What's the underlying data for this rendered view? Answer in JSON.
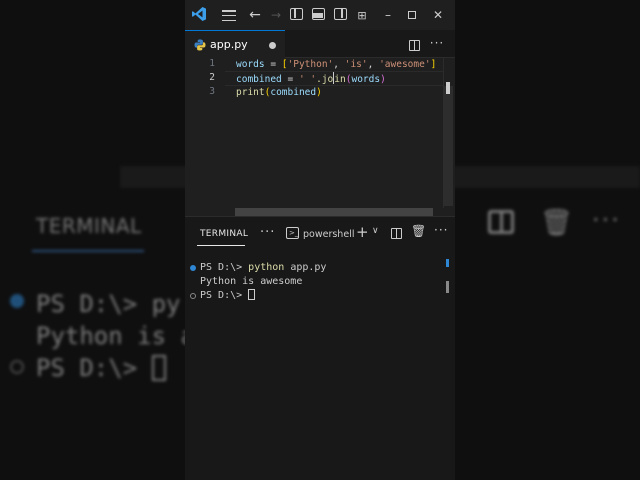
{
  "background": {
    "terminal_label": "TERMINAL",
    "lines": [
      "PS D:\\> py",
      "Python is a",
      "PS D:\\> "
    ]
  },
  "window": {
    "tab": {
      "filename": "app.py",
      "modified": true
    },
    "editor": {
      "line_numbers": [
        "1",
        "2",
        "3"
      ],
      "code": {
        "l1": {
          "v": "words",
          "eq": " = ",
          "br1": "[",
          "s1": "'Python'",
          "c1": ", ",
          "s2": "'is'",
          "c2": ", ",
          "s3": "'awesome'",
          "br2": "]"
        },
        "l2": {
          "v": "combined",
          "eq": " = ",
          "s": "' '",
          "dot": ".jo",
          "f2": "in",
          "p1": "(",
          "arg": "words",
          "p2": ")"
        },
        "l3": {
          "f": "print",
          "p1": "(",
          "arg": "combined",
          "p2": ")"
        }
      }
    },
    "panel": {
      "tab_label": "TERMINAL",
      "shell_label": "powershell",
      "terminal_lines": {
        "prompt1": "PS D:\\> ",
        "cmd1": "python",
        "args1": " app.py",
        "output": "Python is awesome",
        "prompt2": "PS D:\\> "
      }
    }
  },
  "colors": {
    "accent": "#0078d4",
    "status_blue": "#2f86d2",
    "string": "#ce9178",
    "variable": "#9cdcfe",
    "function": "#dcdcaa"
  }
}
